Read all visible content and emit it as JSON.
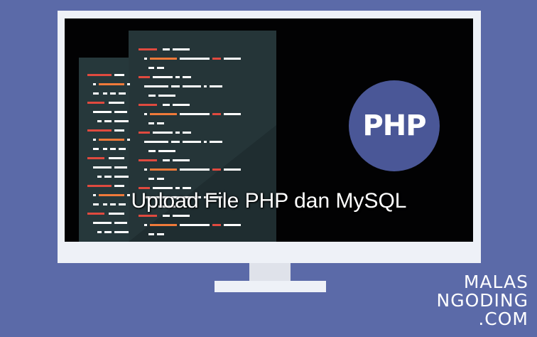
{
  "screen": {
    "title": "Upload File PHP dan MySQL",
    "badge_text": "PHP"
  },
  "logo": {
    "line1": "MALAS",
    "line2": "NGODING",
    "line3": ".COM"
  },
  "colors": {
    "background": "#5b6aa8",
    "monitor": "#eef1f7",
    "badge": "#4a5797",
    "code_red": "#e04a3f",
    "code_orange": "#f07a3a",
    "code_white": "#ffffff"
  }
}
